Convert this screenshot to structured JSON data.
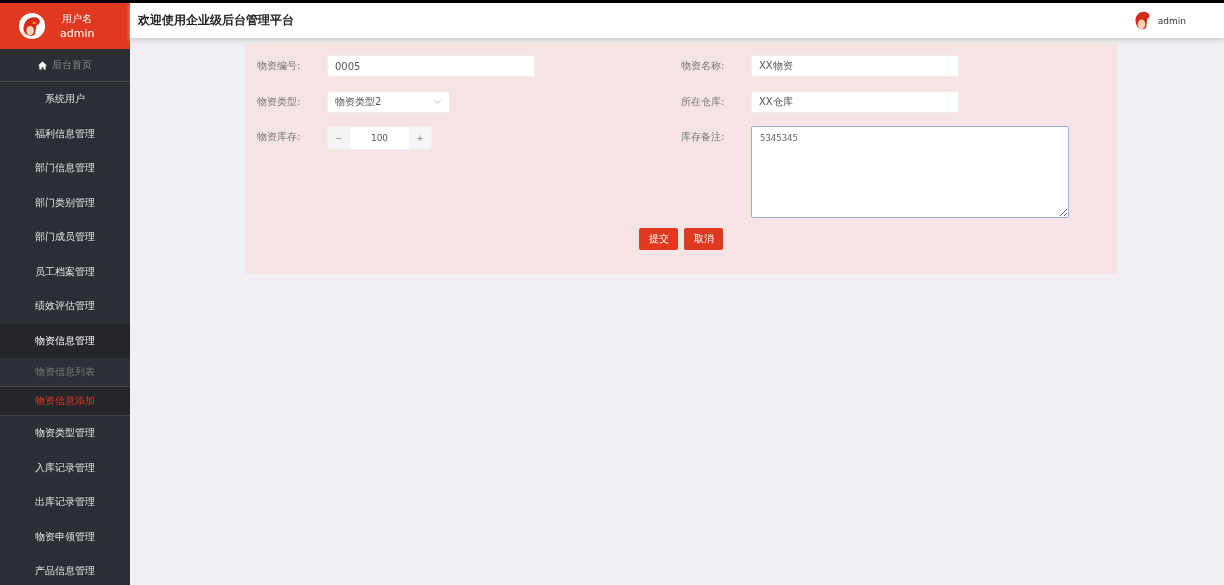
{
  "sidebar": {
    "user_label": "用户名",
    "user_name": "admin",
    "menu": [
      {
        "kind": "home",
        "label": "后台首页"
      },
      {
        "kind": "item",
        "label": "系统用户"
      },
      {
        "kind": "item",
        "label": "福利信息管理"
      },
      {
        "kind": "item",
        "label": "部门信息管理"
      },
      {
        "kind": "item",
        "label": "部门类别管理"
      },
      {
        "kind": "item",
        "label": "部门成员管理"
      },
      {
        "kind": "item",
        "label": "员工档案管理"
      },
      {
        "kind": "item",
        "label": "绩效评估管理"
      },
      {
        "kind": "item",
        "label": "物资信息管理",
        "expanded": true,
        "children": [
          {
            "label": "物资信息列表",
            "selected": false
          },
          {
            "label": "物资信息添加",
            "selected": true
          }
        ]
      },
      {
        "kind": "item",
        "label": "物资类型管理"
      },
      {
        "kind": "item",
        "label": "入库记录管理"
      },
      {
        "kind": "item",
        "label": "出库记录管理"
      },
      {
        "kind": "item",
        "label": "物资申领管理"
      },
      {
        "kind": "item",
        "label": "产品信息管理"
      }
    ]
  },
  "header": {
    "title": "欢迎使用企业级后台管理平台",
    "user": "admin"
  },
  "form": {
    "columns": [
      [
        {
          "kind": "text",
          "label": "物资编号:",
          "value": "0005",
          "focused": false
        },
        {
          "kind": "select",
          "label": "物资类型:",
          "value": "物资类型2",
          "focused": false
        },
        {
          "kind": "number",
          "label": "物资库存:",
          "value": "100",
          "minus": "−",
          "plus": "+",
          "focused": false
        }
      ],
      [
        {
          "kind": "text",
          "label": "物资名称:",
          "value": "XX物资",
          "focused": false
        },
        {
          "kind": "text",
          "label": "所在仓库:",
          "value": "XX仓库",
          "focused": false
        },
        {
          "kind": "textarea",
          "label": "库存备注:",
          "value": "5345345",
          "focused": true
        }
      ]
    ],
    "buttons": [
      "提交",
      "取消"
    ]
  }
}
